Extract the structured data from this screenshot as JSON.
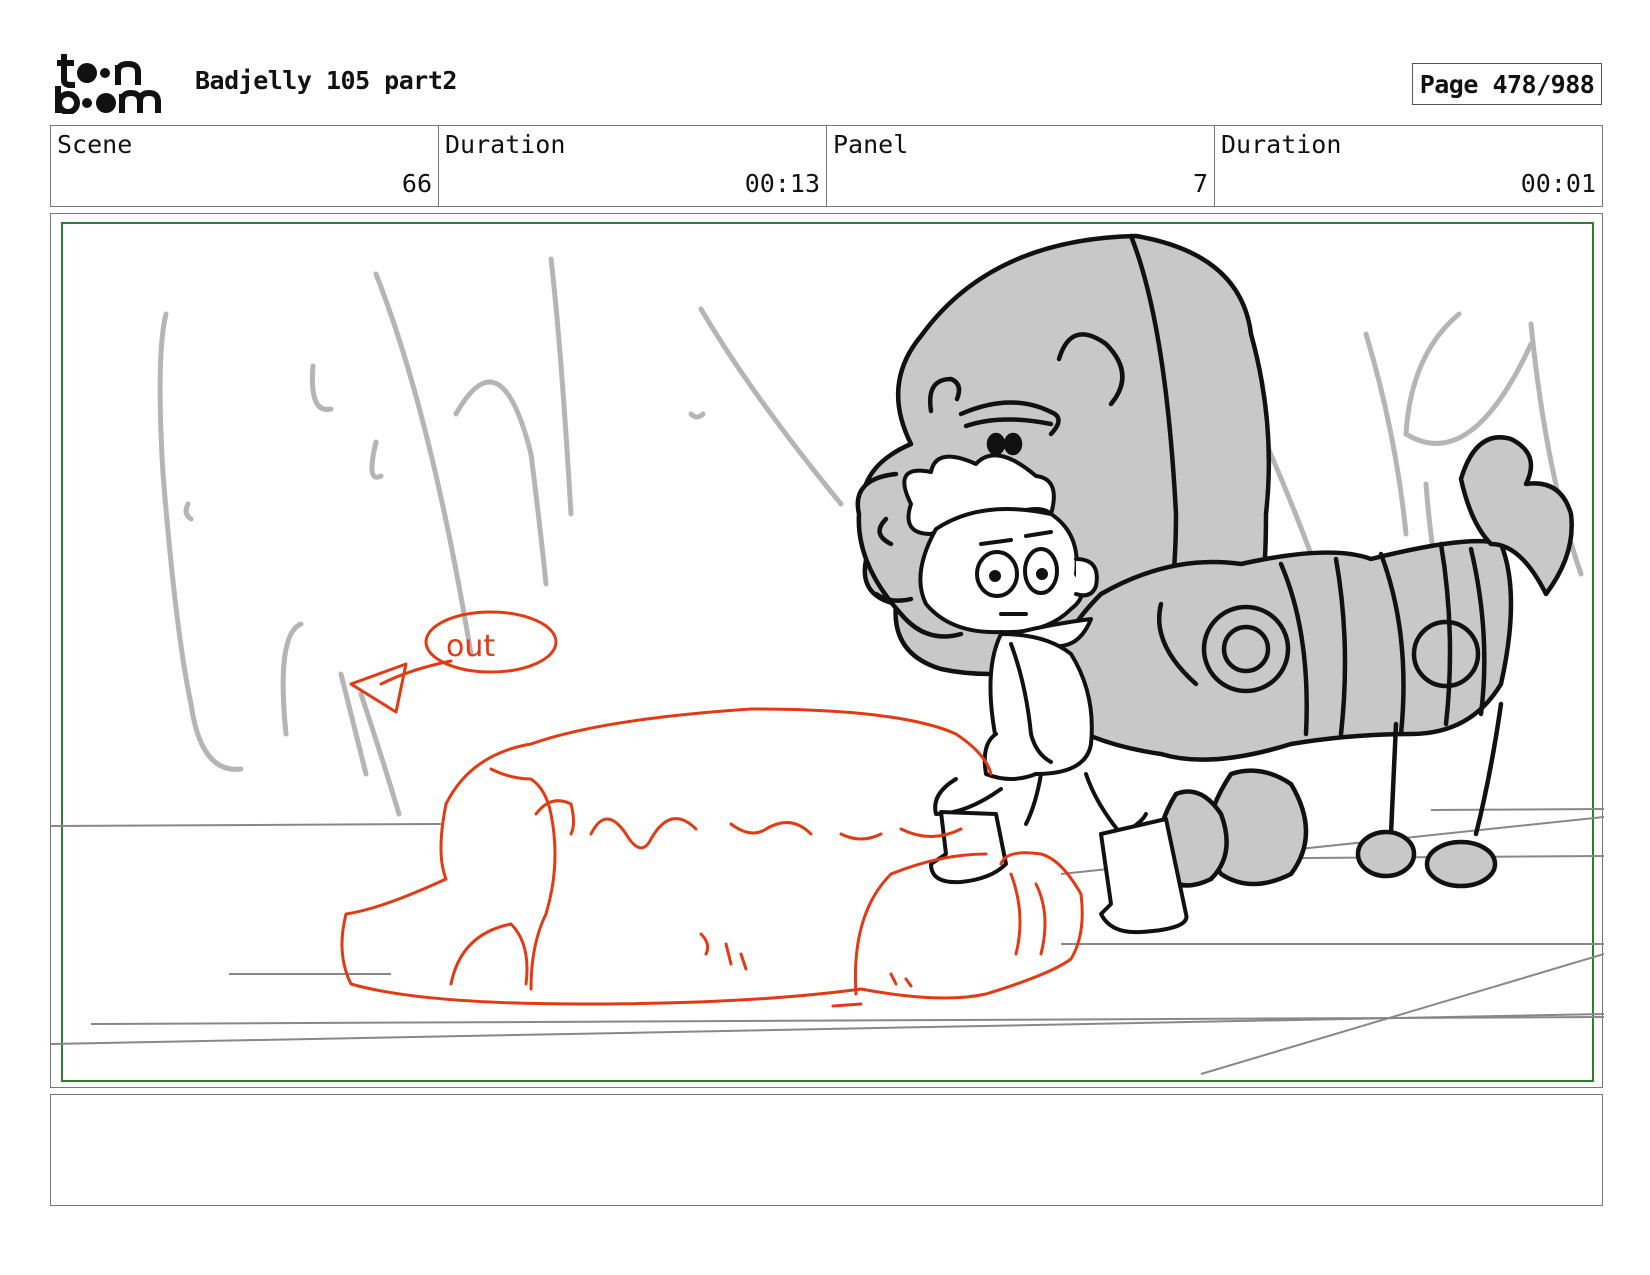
{
  "header": {
    "logo_text": "toon boom",
    "title": "Badjelly 105 part2",
    "page_label": "Page 478/988"
  },
  "info": {
    "scene_label": "Scene",
    "scene_value": "66",
    "scene_duration_label": "Duration",
    "scene_duration_value": "00:13",
    "panel_label": "Panel",
    "panel_value": "7",
    "panel_duration_label": "Duration",
    "panel_duration_value": "00:01"
  },
  "drawing": {
    "annotation": "out",
    "colors": {
      "frame": "#2e7d32",
      "annotation": "#e23a12",
      "sketch_gray": "#b5b5b5",
      "fill_gray": "#c8c8c8",
      "ink": "#111111"
    }
  },
  "notes": {
    "text": ""
  }
}
